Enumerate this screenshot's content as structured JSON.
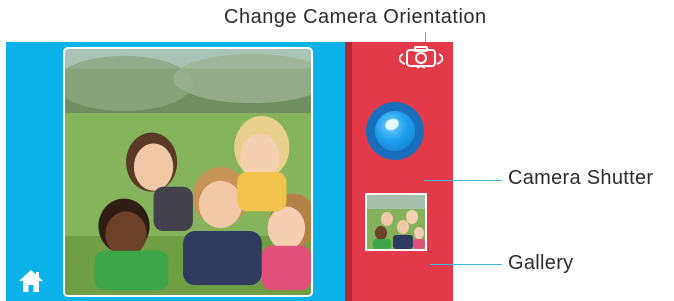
{
  "callouts": {
    "orientation": "Change Camera Orientation",
    "shutter": "Camera Shutter",
    "gallery": "Gallery"
  },
  "icons": {
    "home": "home-icon",
    "orientation": "camera-rotate-icon",
    "shutter": "shutter-button",
    "gallery": "gallery-thumbnail"
  },
  "colors": {
    "camera_view_bg": "#0bb2ea",
    "control_panel_bg": "#e23a48",
    "shutter_outer": "#1a6fbd",
    "shutter_inner": "#1ea0ee",
    "callout_line": "#3bb8e4"
  }
}
